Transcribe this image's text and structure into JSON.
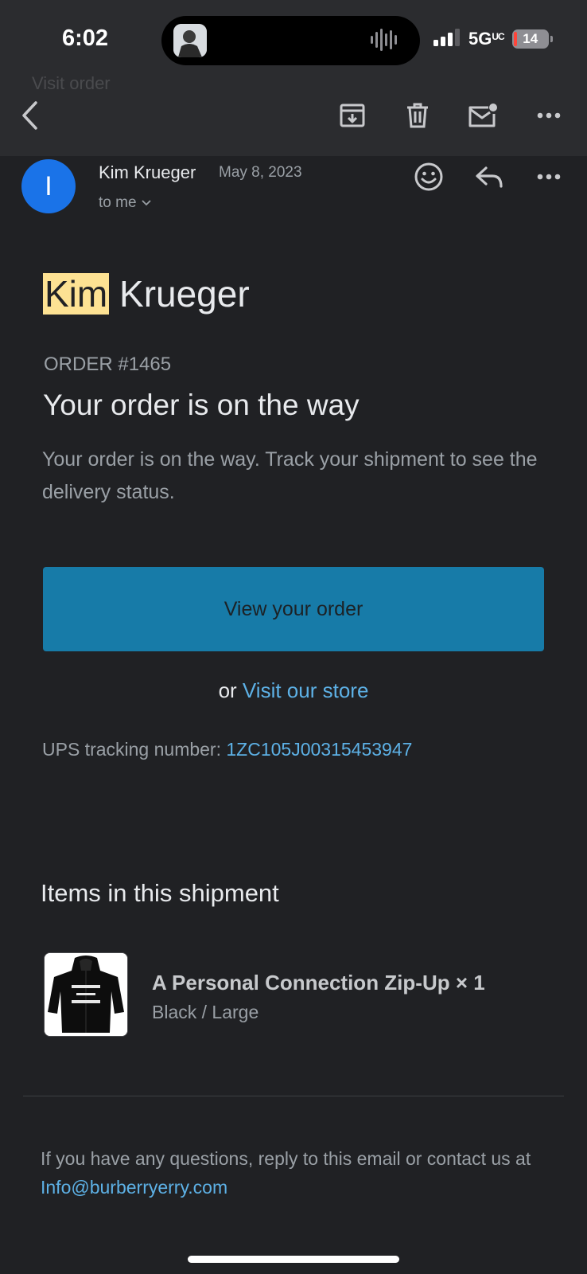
{
  "status_bar": {
    "time": "6:02",
    "network": "5G",
    "network_suffix": "UC",
    "battery": "14"
  },
  "toolbar": {
    "back_icon": "chevron-left-icon",
    "archive_icon": "archive-icon",
    "delete_icon": "trash-icon",
    "mark_unread_icon": "mail-unread-icon",
    "more_icon": "more-horizontal-icon"
  },
  "background_preview": "Visit order",
  "sender": {
    "avatar_letter": "I",
    "name": "Kim Krueger",
    "date": "May 8, 2023",
    "recipient": "to me",
    "avatar_color": "#1a73e8"
  },
  "email": {
    "name_highlight": "Kim",
    "name_rest": " Krueger",
    "order_number": "ORDER #1465",
    "headline": "Your order is on the way",
    "description": "Your order is on the way. Track your shipment to see the delivery status.",
    "button_label": "View your order",
    "or_text": "or ",
    "store_link": "Visit our store",
    "tracking_label": "UPS tracking number: ",
    "tracking_number": "1ZC105J00315453947",
    "items_heading": "Items in this shipment",
    "item": {
      "name": "A Personal Connection Zip-Up × 1",
      "variant": "Black / Large"
    },
    "footer_text": "If you have any questions, reply to this email or contact us at ",
    "footer_email": "Info@burberryerry.com"
  },
  "colors": {
    "background": "#202124",
    "button": "#177ba8",
    "link": "#5db1e6",
    "highlight": "#fde293"
  }
}
